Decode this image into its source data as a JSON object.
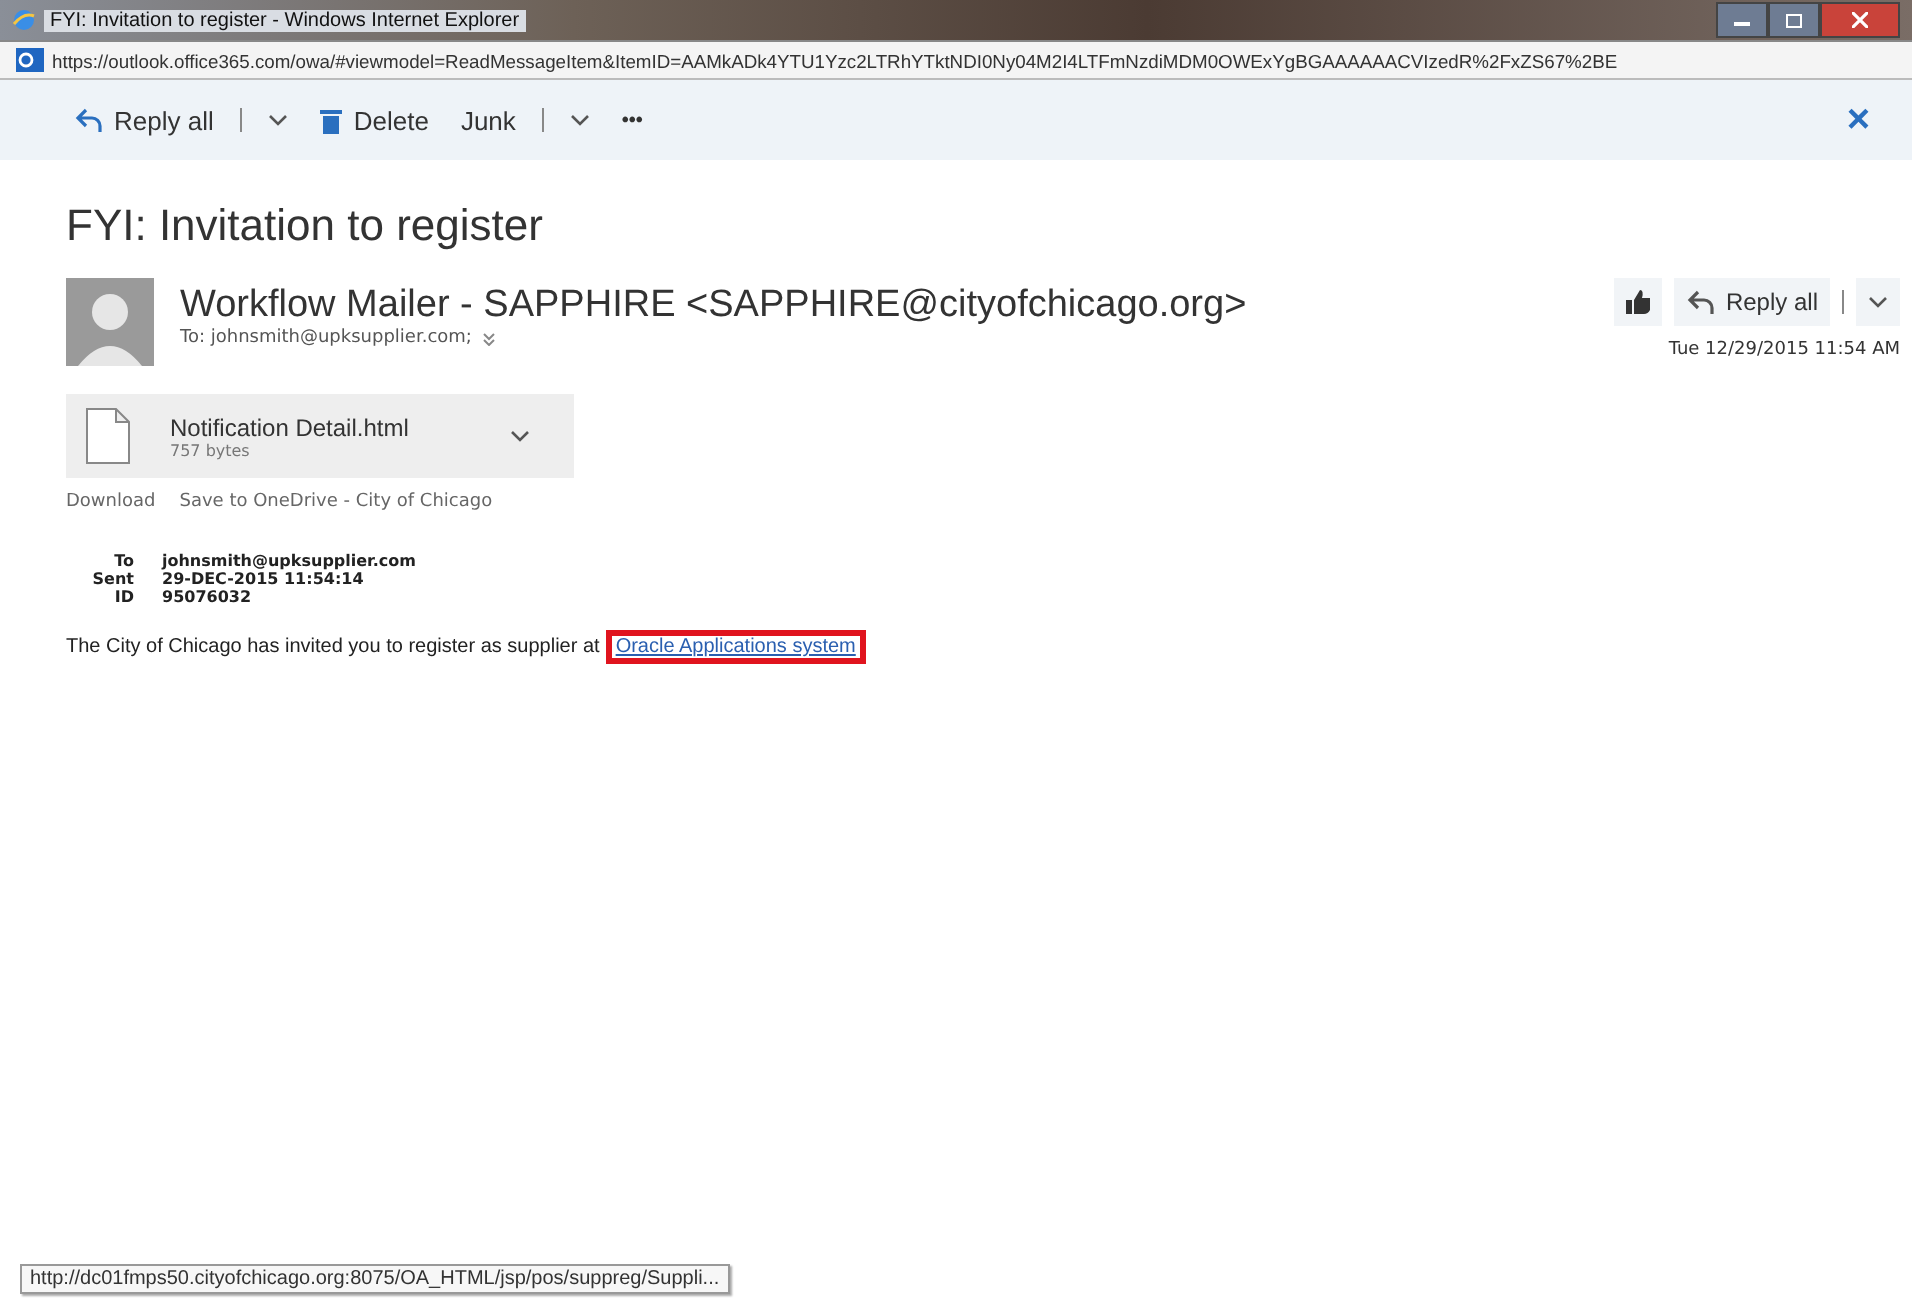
{
  "window": {
    "title": "FYI: Invitation to register - Windows Internet Explorer"
  },
  "address_bar": {
    "url": "https://outlook.office365.com/owa/#viewmodel=ReadMessageItem&ItemID=AAMkADk4YTU1Yzc2LTRhYTktNDI0Ny04M2I4LTFmNzdiMDM0OWExYgBGAAAAAACVIzedR%2FxZS67%2BE"
  },
  "toolbar": {
    "reply_all": "Reply all",
    "delete": "Delete",
    "junk": "Junk",
    "more": "•••",
    "close": "×"
  },
  "message": {
    "subject": "FYI: Invitation to register",
    "sender": "Workflow Mailer - SAPPHIRE <SAPPHIRE@cityofchicago.org>",
    "to": "To: johnsmith@upksupplier.com;",
    "reply_all": "Reply all",
    "date": "Tue 12/29/2015 11:54 AM",
    "attachment": {
      "name": "Notification Detail.html",
      "size": "757 bytes"
    },
    "attachment_actions": [
      "Download",
      "Save to OneDrive - City of Chicago"
    ],
    "fields": [
      {
        "label": "To",
        "value": "johnsmith@upksupplier.com"
      },
      {
        "label": "Sent",
        "value": "29-DEC-2015 11:54:14"
      },
      {
        "label": "ID",
        "value": "95076032"
      }
    ],
    "body": "The City of Chicago has invited you to register as supplier at",
    "link": {
      "text": "Oracle Applications system",
      "highlighted": true
    }
  },
  "status_bar": {
    "url": "http://dc01fmps50.cityofchicago.org:8075/OA_HTML/jsp/pos/suppreg/Suppli..."
  }
}
